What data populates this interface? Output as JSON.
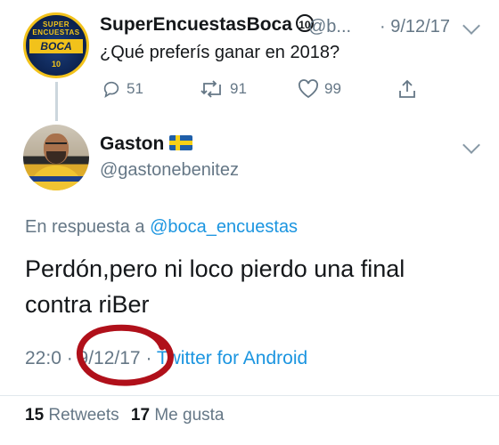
{
  "parent_tweet": {
    "avatar_label": "SUPER ENCUESTAS",
    "avatar_team": "BOCA",
    "avatar_number": "10",
    "display_name": "SuperEncuestasBoca",
    "badge": "10",
    "handle": "@b...",
    "date": "· 9/12/17",
    "text": "¿Qué preferís ganar en 2018?",
    "replies": "51",
    "retweets": "91",
    "likes": "99"
  },
  "reply_tweet": {
    "display_name": "Gaston",
    "handle": "@gastonebenitez",
    "in_reply_prefix": "En respuesta a",
    "in_reply_handle": "@boca_encuestas",
    "text": "Perdón,pero ni loco pierdo una final contra riBer",
    "time": "22:0",
    "date": "· 9/12/17 ·",
    "source": "Twitter for Android",
    "retweets_count": "15",
    "retweets_label": "Retweets",
    "likes_count": "17",
    "likes_label": "Me gusta"
  },
  "annotation_color": "#b0101a",
  "colors": {
    "link": "#1b95e0",
    "muted": "#657786",
    "text": "#14171a"
  }
}
